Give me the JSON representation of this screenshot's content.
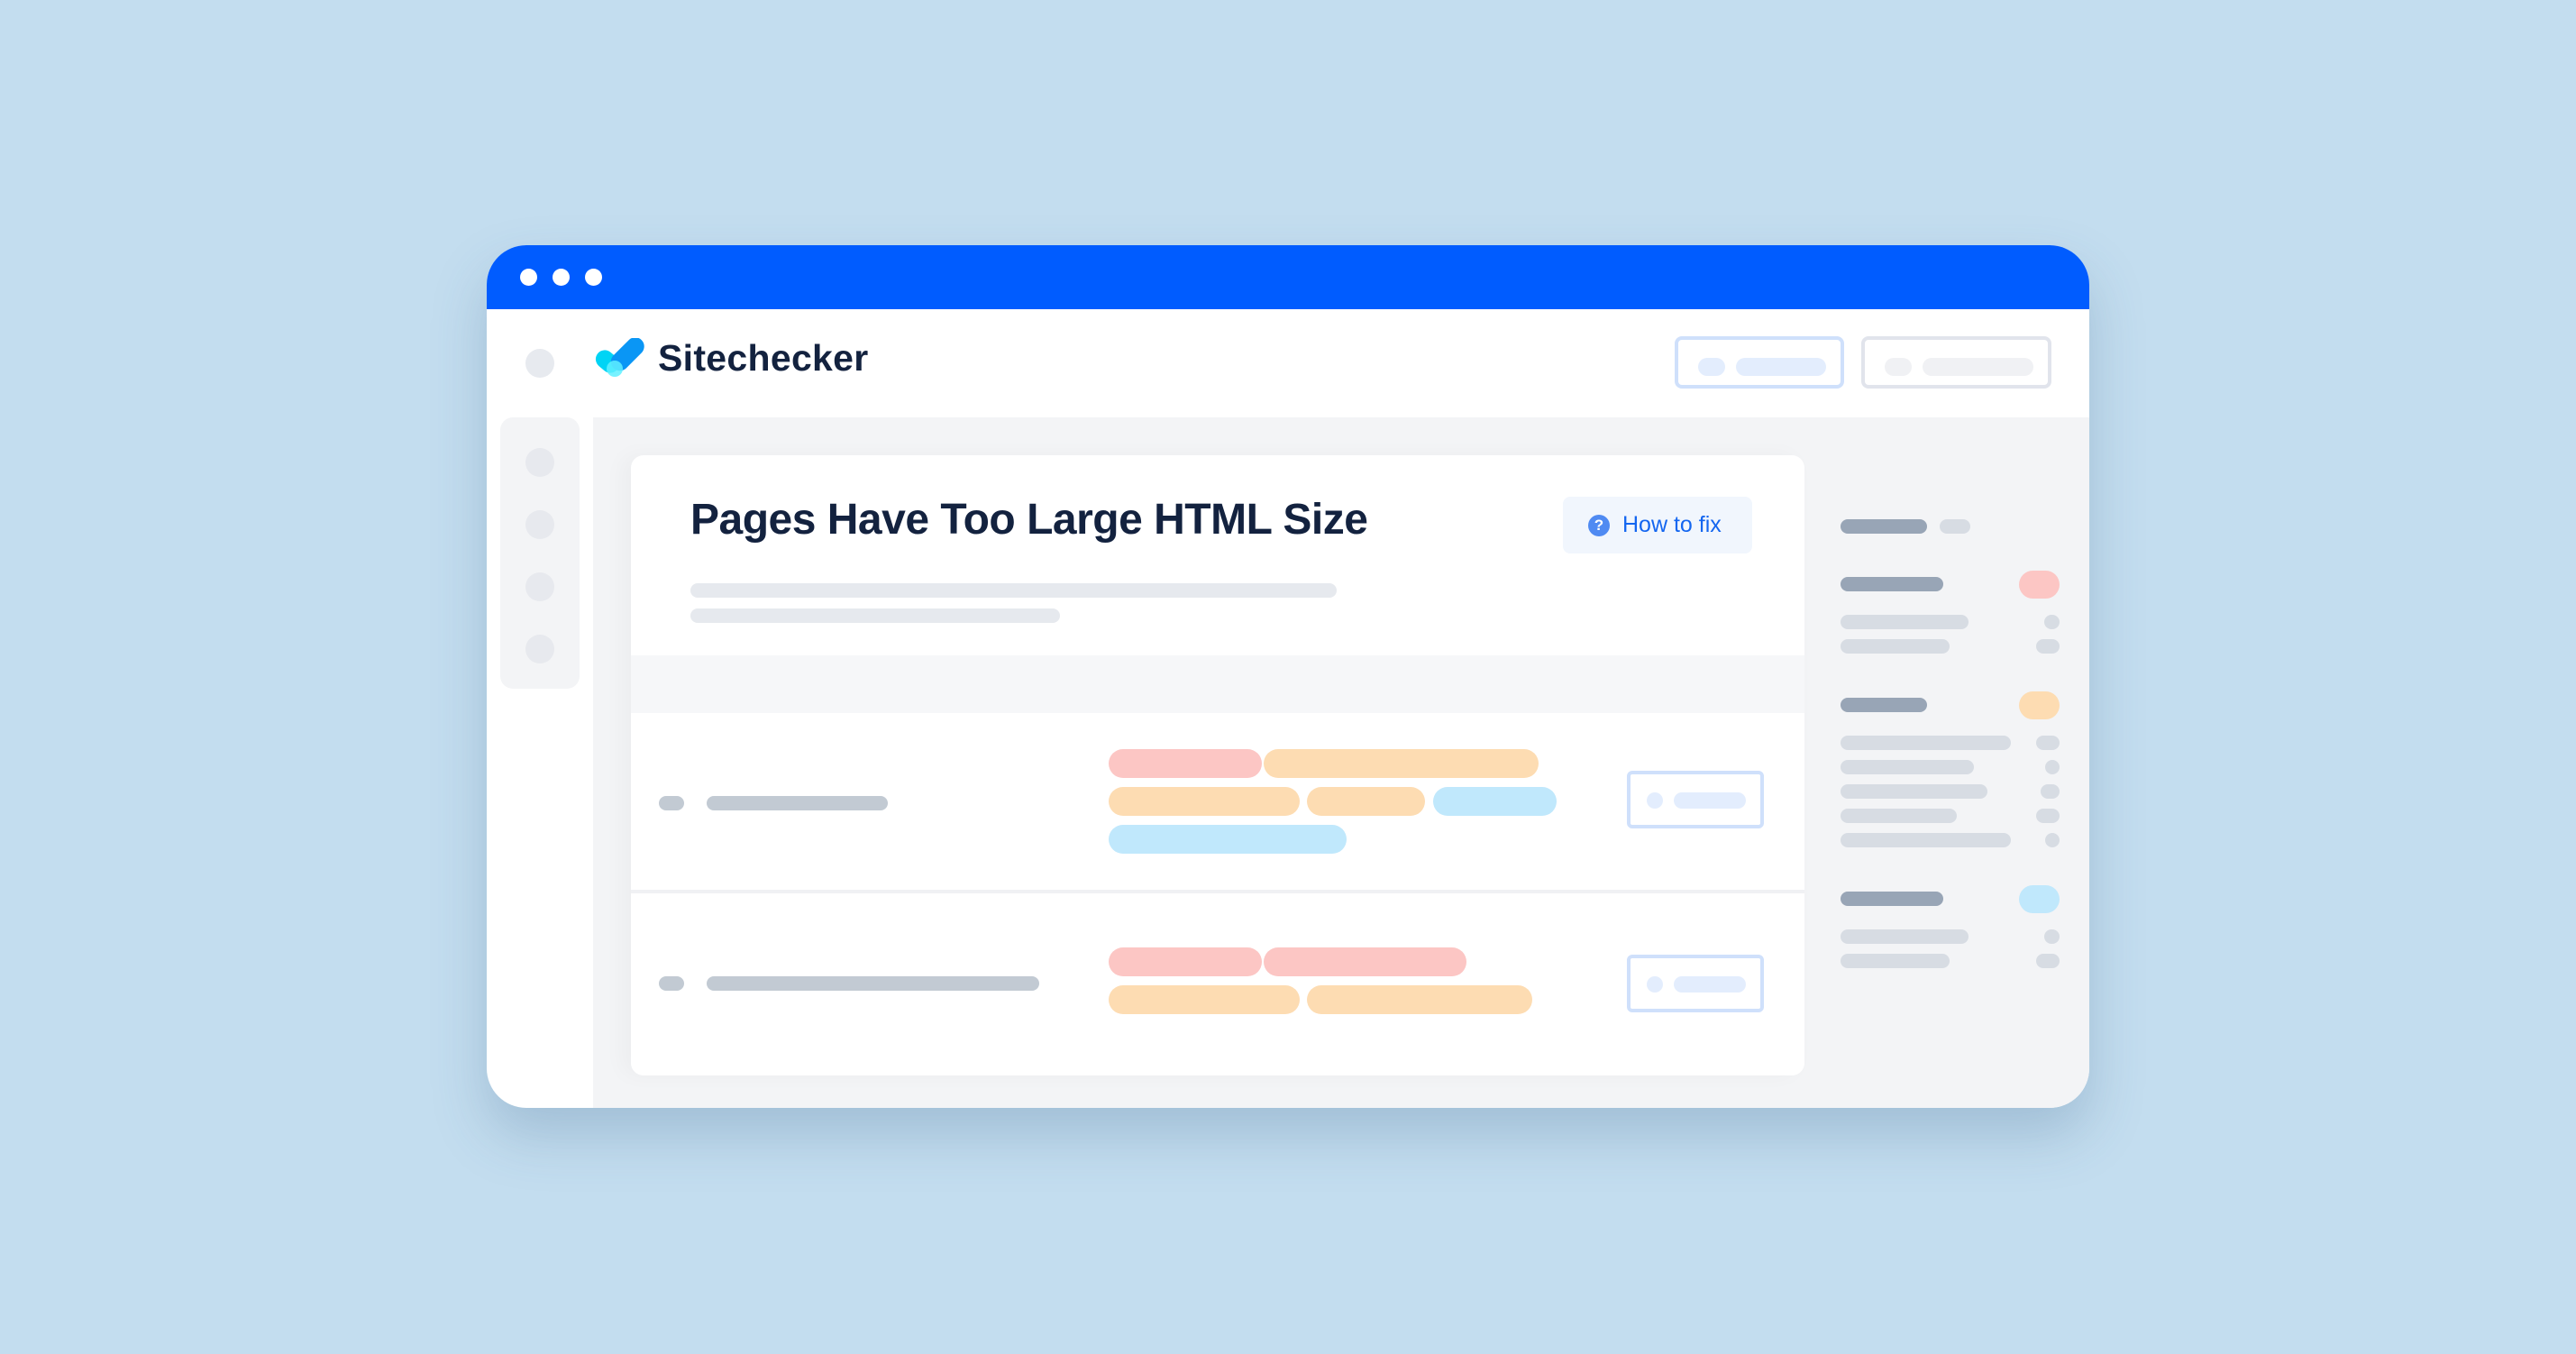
{
  "window": {
    "titlebar_color": "#005cff",
    "traffic_dots": [
      "dot",
      "dot",
      "dot"
    ]
  },
  "header": {
    "logo": {
      "icon": "checkmark-logo-icon",
      "text": "Sitechecker"
    },
    "buttons": [
      {
        "name": "primary-placeholder-button",
        "style": "blue-outline"
      },
      {
        "name": "secondary-placeholder-button",
        "style": "gray-outline"
      }
    ]
  },
  "sidebar": {
    "items": [
      "nav-item-1",
      "nav-item-2",
      "nav-item-3",
      "nav-item-4"
    ]
  },
  "card": {
    "title": "Pages Have Too Large HTML Size",
    "how_to_fix": {
      "icon": "question-circle-icon",
      "icon_glyph": "?",
      "label": "How to fix"
    },
    "rows": [
      {
        "tags": [
          [
            "red",
            "orange"
          ],
          [
            "orange",
            "orange",
            "blue"
          ],
          [
            "blue"
          ]
        ]
      },
      {
        "tags": [
          [
            "red",
            "red"
          ],
          [
            "orange",
            "orange"
          ]
        ]
      }
    ]
  },
  "right_panel": {
    "groups": [
      {
        "badge": "none",
        "sub_items": 0
      },
      {
        "badge": "red",
        "sub_items": 2
      },
      {
        "badge": "orange",
        "sub_items": 5
      },
      {
        "badge": "blue",
        "sub_items": 2
      }
    ]
  },
  "colors": {
    "brand_blue": "#005cff",
    "title_text": "#13223f",
    "link_blue": "#1466f0",
    "tag_red": "#fcc6c4",
    "tag_orange": "#fddcb2",
    "tag_blue": "#c0e8fc",
    "background": "#c3ddef"
  }
}
